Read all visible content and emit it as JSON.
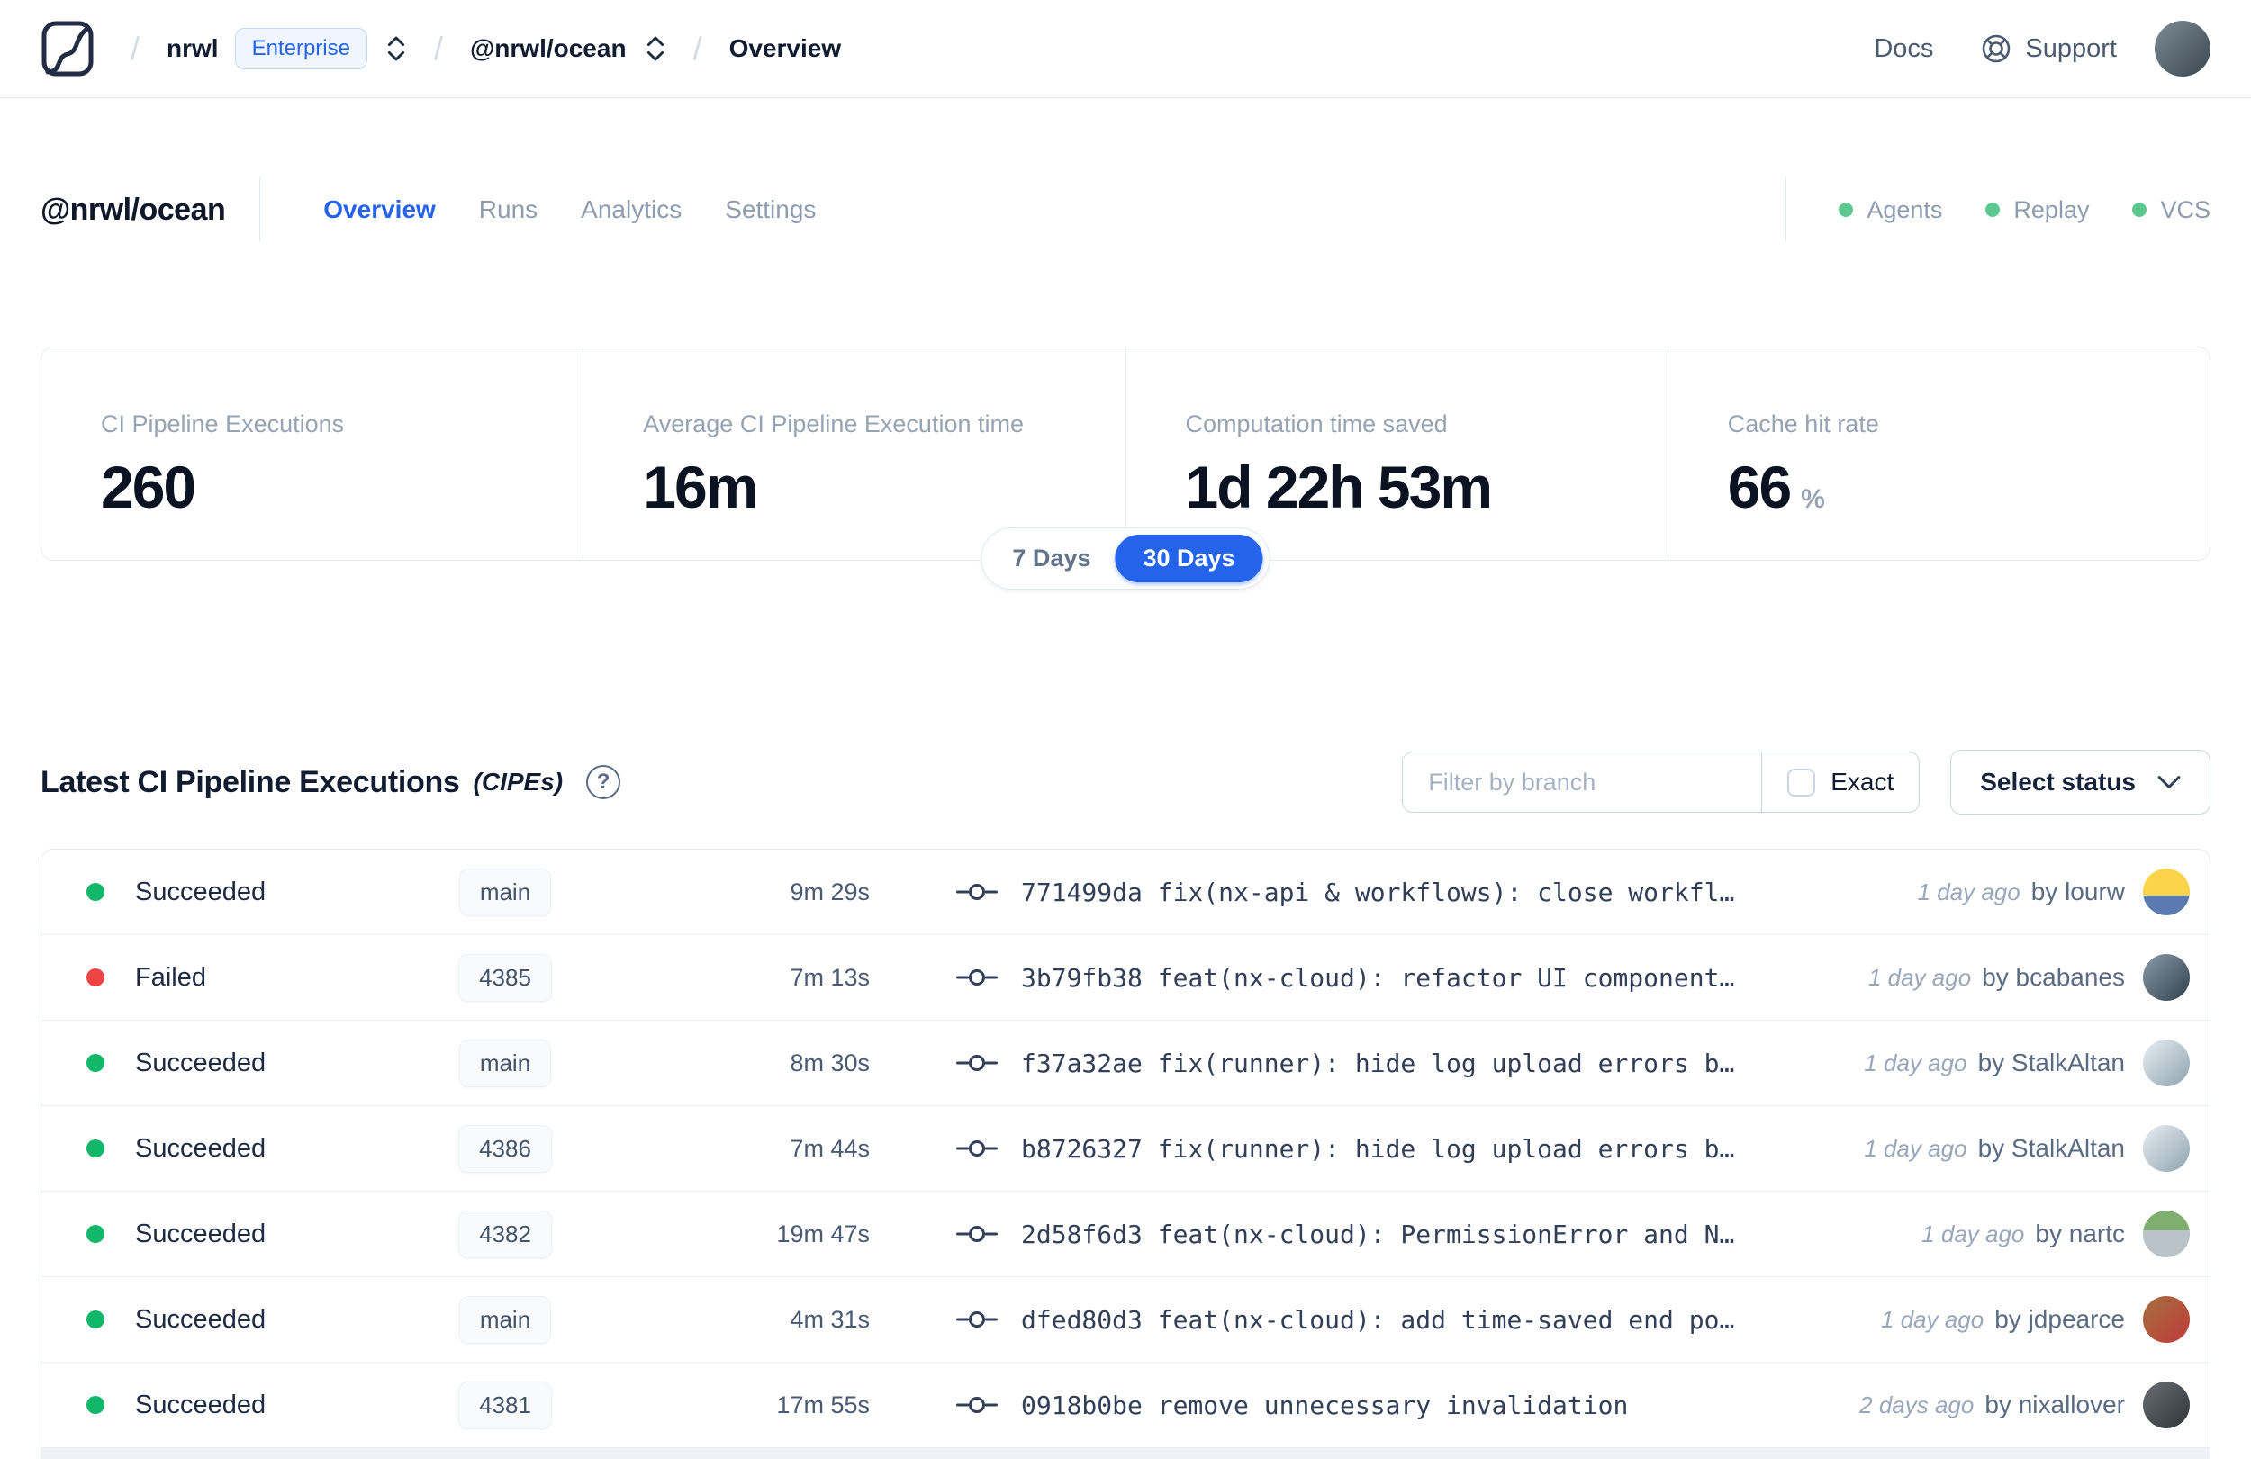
{
  "colors": {
    "accent": "#2563eb",
    "success_dot": "#12b76a",
    "failed_dot": "#ef4444",
    "health_dot": "#5ec98f"
  },
  "icons": {
    "breadcrumb_separator": "/",
    "help_glyph": "?"
  },
  "nav": {
    "org": "nrwl",
    "org_badge": "Enterprise",
    "workspace": "@nrwl/ocean",
    "page": "Overview",
    "docs": "Docs",
    "support": "Support",
    "avatar_style": "background:linear-gradient(135deg,#7e8c96,#39464f)"
  },
  "header": {
    "title": "@nrwl/ocean",
    "tabs": [
      {
        "label": "Overview",
        "active": true
      },
      {
        "label": "Runs",
        "active": false
      },
      {
        "label": "Analytics",
        "active": false
      },
      {
        "label": "Settings",
        "active": false
      }
    ],
    "health": [
      {
        "label": "Agents"
      },
      {
        "label": "Replay"
      },
      {
        "label": "VCS"
      }
    ]
  },
  "stats": {
    "cards": [
      {
        "label": "CI Pipeline Executions",
        "value": "260",
        "suffix": ""
      },
      {
        "label": "Average CI Pipeline Execution time",
        "value": "16m",
        "suffix": ""
      },
      {
        "label": "Computation time saved",
        "value": "1d 22h 53m",
        "suffix": ""
      },
      {
        "label": "Cache hit rate",
        "value": "66",
        "suffix": "%"
      }
    ],
    "range": {
      "options": [
        "7 Days",
        "30 Days"
      ],
      "selected": "30 Days"
    }
  },
  "cipe": {
    "title": "Latest CI Pipeline Executions",
    "title_suffix": "(CIPEs)",
    "filter_placeholder": "Filter by branch",
    "exact_label": "Exact",
    "select_status_label": "Select status",
    "rows": [
      {
        "status": "Succeeded",
        "branch": "main",
        "duration": "9m 29s",
        "commit": "771499da fix(nx-api & workflows): close workfl…",
        "time_ago": "1 day ago",
        "author": "by lourw",
        "avatar_style": "background:linear-gradient(180deg,#fbd44c 58%,#5b7bb0 58%)"
      },
      {
        "status": "Failed",
        "branch": "4385",
        "duration": "7m 13s",
        "commit": "3b79fb38 feat(nx-cloud): refactor UI component…",
        "time_ago": "1 day ago",
        "author": "by bcabanes",
        "avatar_style": "background:linear-gradient(135deg,#8a9aa8,#31404e)"
      },
      {
        "status": "Succeeded",
        "branch": "main",
        "duration": "8m 30s",
        "commit": "f37a32ae fix(runner): hide log upload errors b…",
        "time_ago": "1 day ago",
        "author": "by StalkAltan",
        "avatar_style": "background:linear-gradient(135deg,#e8eef2,#8fa3b0)"
      },
      {
        "status": "Succeeded",
        "branch": "4386",
        "duration": "7m 44s",
        "commit": "b8726327 fix(runner): hide log upload errors b…",
        "time_ago": "1 day ago",
        "author": "by StalkAltan",
        "avatar_style": "background:linear-gradient(135deg,#e8eef2,#8fa3b0)"
      },
      {
        "status": "Succeeded",
        "branch": "4382",
        "duration": "19m 47s",
        "commit": "2d58f6d3 feat(nx-cloud): PermissionError and N…",
        "time_ago": "1 day ago",
        "author": "by nartc",
        "avatar_style": "background:linear-gradient(180deg,#7fae6e 42%,#b9c3c9 42%)"
      },
      {
        "status": "Succeeded",
        "branch": "main",
        "duration": "4m 31s",
        "commit": "dfed80d3 feat(nx-cloud): add time-saved end po…",
        "time_ago": "1 day ago",
        "author": "by jdpearce",
        "avatar_style": "background:linear-gradient(135deg,#a4703f,#c03a3a)"
      },
      {
        "status": "Succeeded",
        "branch": "4381",
        "duration": "17m 55s",
        "commit": "0918b0be remove unnecessary invalidation",
        "time_ago": "2 days ago",
        "author": "by nixallover",
        "avatar_style": "background:linear-gradient(135deg,#6b6f73,#2f3438)"
      }
    ]
  }
}
